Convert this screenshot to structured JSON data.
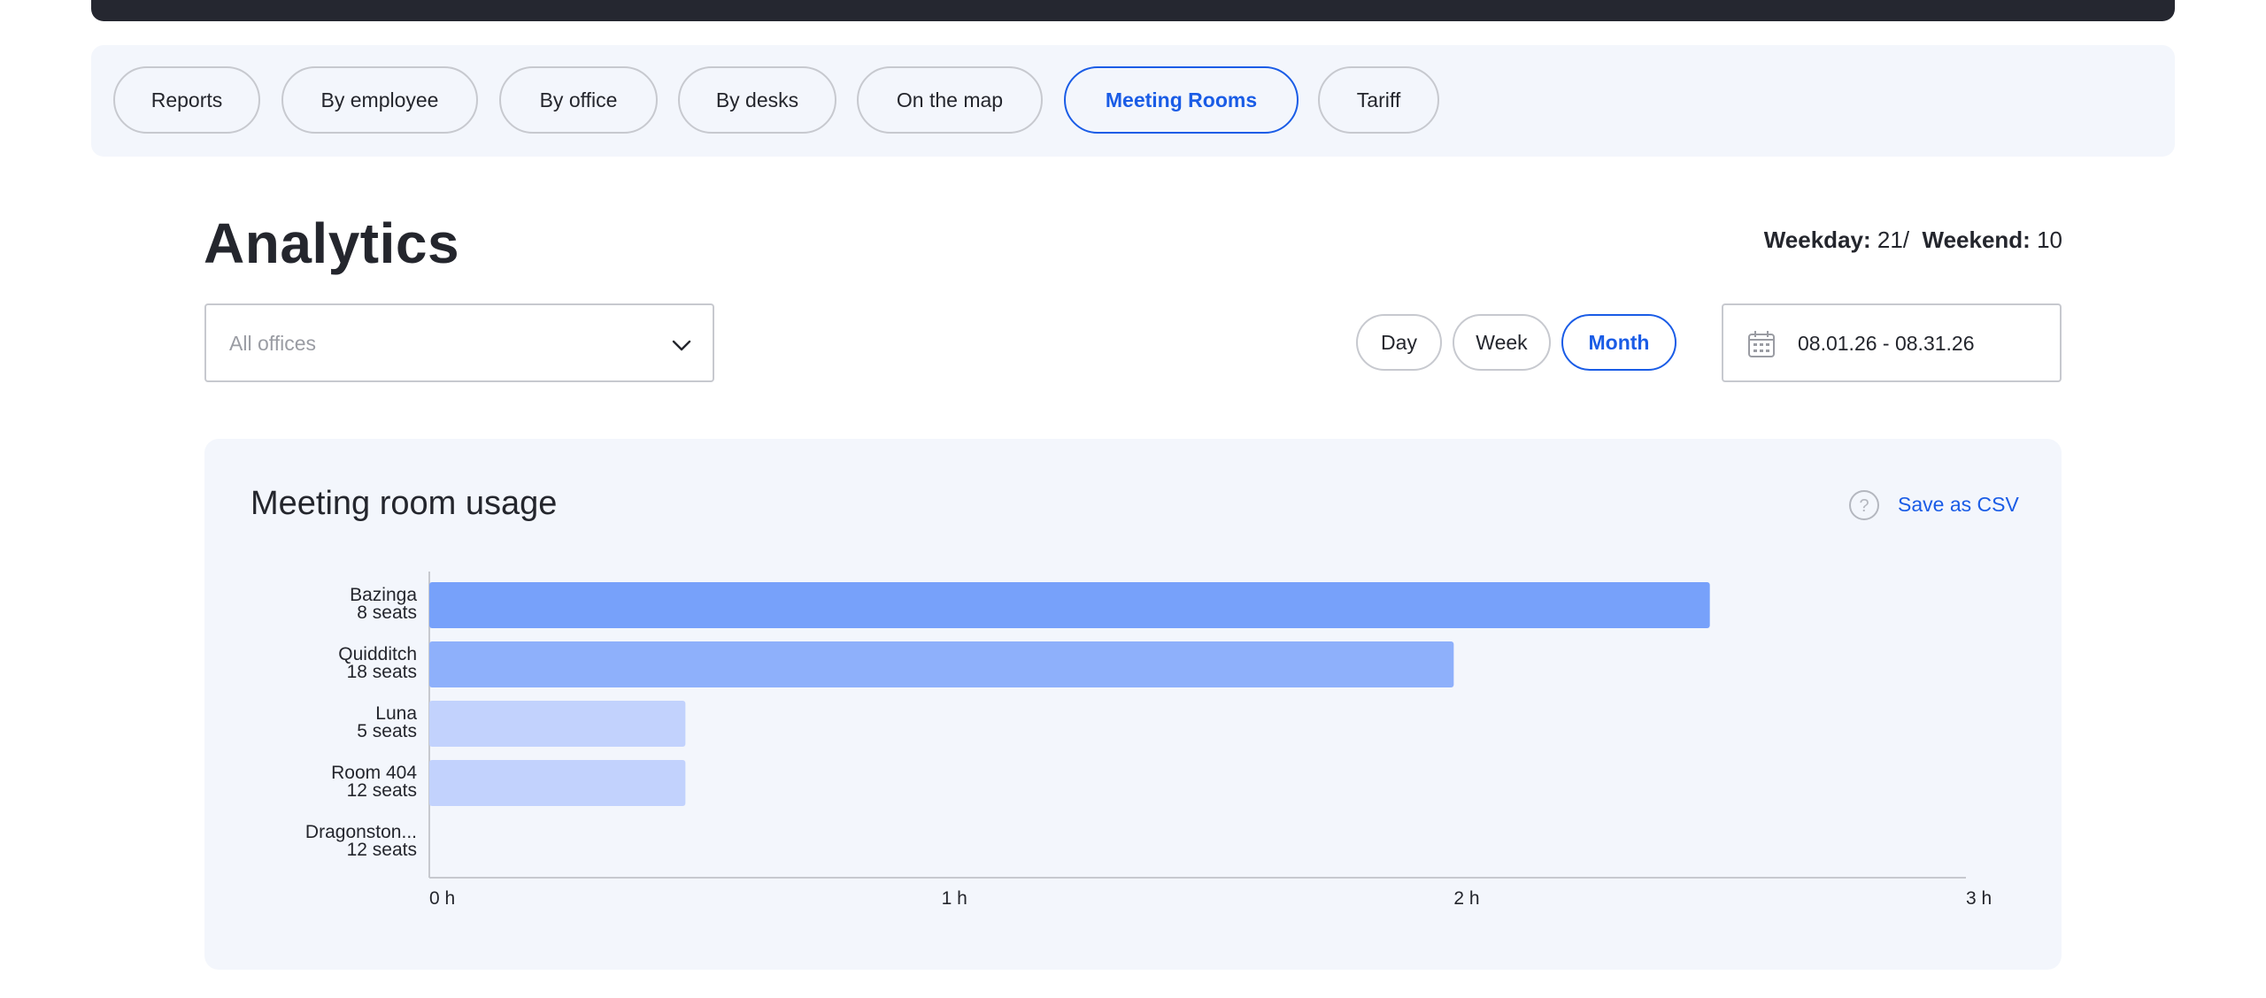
{
  "tabs": [
    {
      "label": "Reports",
      "active": false
    },
    {
      "label": "By employee",
      "active": false
    },
    {
      "label": "By office",
      "active": false
    },
    {
      "label": "By desks",
      "active": false
    },
    {
      "label": "On the map",
      "active": false
    },
    {
      "label": "Meeting Rooms",
      "active": true
    },
    {
      "label": "Tariff",
      "active": false
    }
  ],
  "header": {
    "title": "Analytics",
    "weekday_label": "Weekday:",
    "weekday_value": "21",
    "separator": "/",
    "weekend_label": "Weekend:",
    "weekend_value": "10"
  },
  "office_select": {
    "placeholder": "All offices",
    "icon": "chevron-down-icon"
  },
  "periods": [
    {
      "label": "Day",
      "active": false
    },
    {
      "label": "Week",
      "active": false
    },
    {
      "label": "Month",
      "active": true
    }
  ],
  "date_range": {
    "value": "08.01.26 - 08.31.26",
    "icon": "calendar-icon"
  },
  "card": {
    "title": "Meeting room usage",
    "help_icon": "question-icon",
    "save_label": "Save as CSV"
  },
  "colors": {
    "accent": "#1a5ce6",
    "topbar": "#252730",
    "panel": "#f3f6fc",
    "bar_high": "#77a1fa",
    "bar_mid": "#8eb0fb",
    "bar_low": "#c2d2fd"
  },
  "chart_data": {
    "type": "bar",
    "orientation": "horizontal",
    "categories": [
      {
        "name": "Bazinga",
        "seats": "8 seats"
      },
      {
        "name": "Quidditch",
        "seats": "18 seats"
      },
      {
        "name": "Luna",
        "seats": "5 seats"
      },
      {
        "name": "Room 404",
        "seats": "12 seats"
      },
      {
        "name": "Dragonston...",
        "seats": "12 seats"
      }
    ],
    "values": [
      2.5,
      2.0,
      0.5,
      0.5,
      0
    ],
    "unit": "h",
    "xlim": [
      0,
      3
    ],
    "xticks": [
      "0 h",
      "1 h",
      "2 h",
      "3 h"
    ],
    "grid": false,
    "legend": "none"
  }
}
